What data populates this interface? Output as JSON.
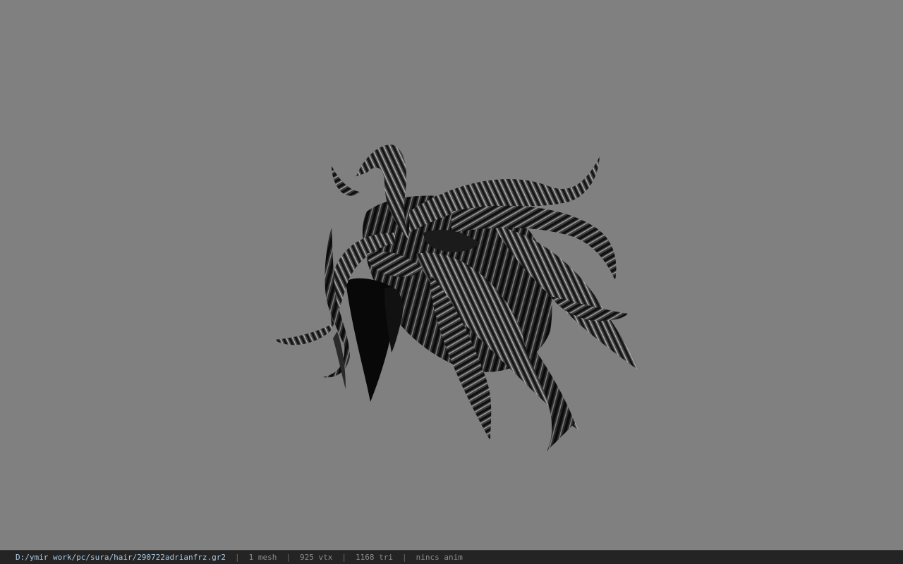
{
  "statusbar": {
    "path": "D:/ymir work/pc/sura/hair/290722adrianfrz.gr2",
    "separator": "|",
    "mesh": "1 mesh",
    "vertices": "925 vtx",
    "triangles": "1168 tri",
    "animation": "nincs anim"
  },
  "viewport": {
    "background": "#808080",
    "model": "hair-model"
  }
}
